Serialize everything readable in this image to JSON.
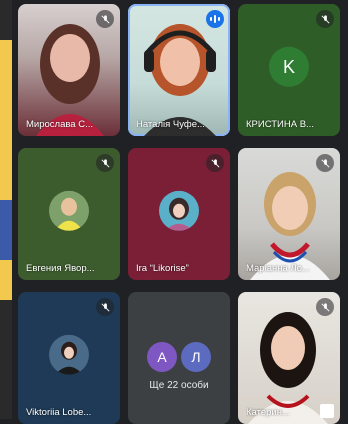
{
  "tiles": [
    {
      "name": "Мирослава С...",
      "kind": "video",
      "muted": true
    },
    {
      "name": "Наталія Чуфе...",
      "kind": "video",
      "speaking": true
    },
    {
      "name": "КРИСТИНА В...",
      "kind": "letter",
      "letter": "K",
      "muted": true
    },
    {
      "name": "Евгения Явор...",
      "kind": "photo",
      "muted": true
    },
    {
      "name": "Ira “Likorise”",
      "kind": "photo",
      "muted": true
    },
    {
      "name": "Маріанна Ло...",
      "kind": "video",
      "muted": true
    },
    {
      "name": "Viktoriia Lobe...",
      "kind": "photo",
      "muted": true
    },
    {
      "name": "",
      "kind": "more"
    },
    {
      "name": "Катерин...",
      "kind": "video",
      "muted": true
    }
  ],
  "more": {
    "avatars": [
      "А",
      "Л"
    ],
    "label": "Ще 22 особи"
  },
  "colors": {
    "tile_green": "#3c5a2f",
    "tile_maroon": "#7b1e35",
    "tile_navy": "#1f3b57",
    "tile_grey": "#3c4043",
    "tile_dark_green": "#1f4a2a",
    "accent_blue": "#1a73e8"
  }
}
